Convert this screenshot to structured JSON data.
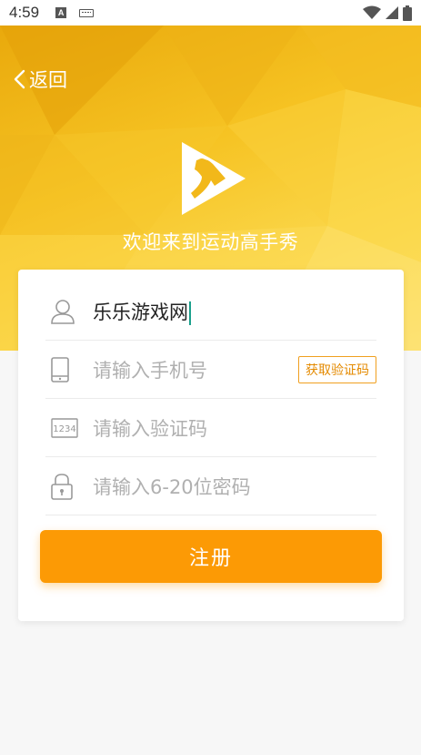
{
  "status_bar": {
    "time": "4:59",
    "notification_letter": "A"
  },
  "header": {
    "back_label": "返回",
    "welcome_text": "欢迎来到运动高手秀"
  },
  "form": {
    "username": {
      "value": "乐乐游戏网"
    },
    "phone": {
      "placeholder": "请输入手机号",
      "get_code_label": "获取验证码"
    },
    "verify_code": {
      "placeholder": "请输入验证码"
    },
    "password": {
      "placeholder": "请输入6-20位密码"
    },
    "submit_label": "注册"
  },
  "colors": {
    "accent": "#fc9a05",
    "hero_yellow": "#f6c323",
    "code_button_border": "#f0a020"
  },
  "icons": [
    "back-chevron-icon",
    "app-logo-icon",
    "user-icon",
    "phone-icon",
    "code-1234-icon",
    "lock-icon",
    "wifi-icon",
    "signal-icon",
    "battery-icon",
    "keyboard-icon"
  ]
}
